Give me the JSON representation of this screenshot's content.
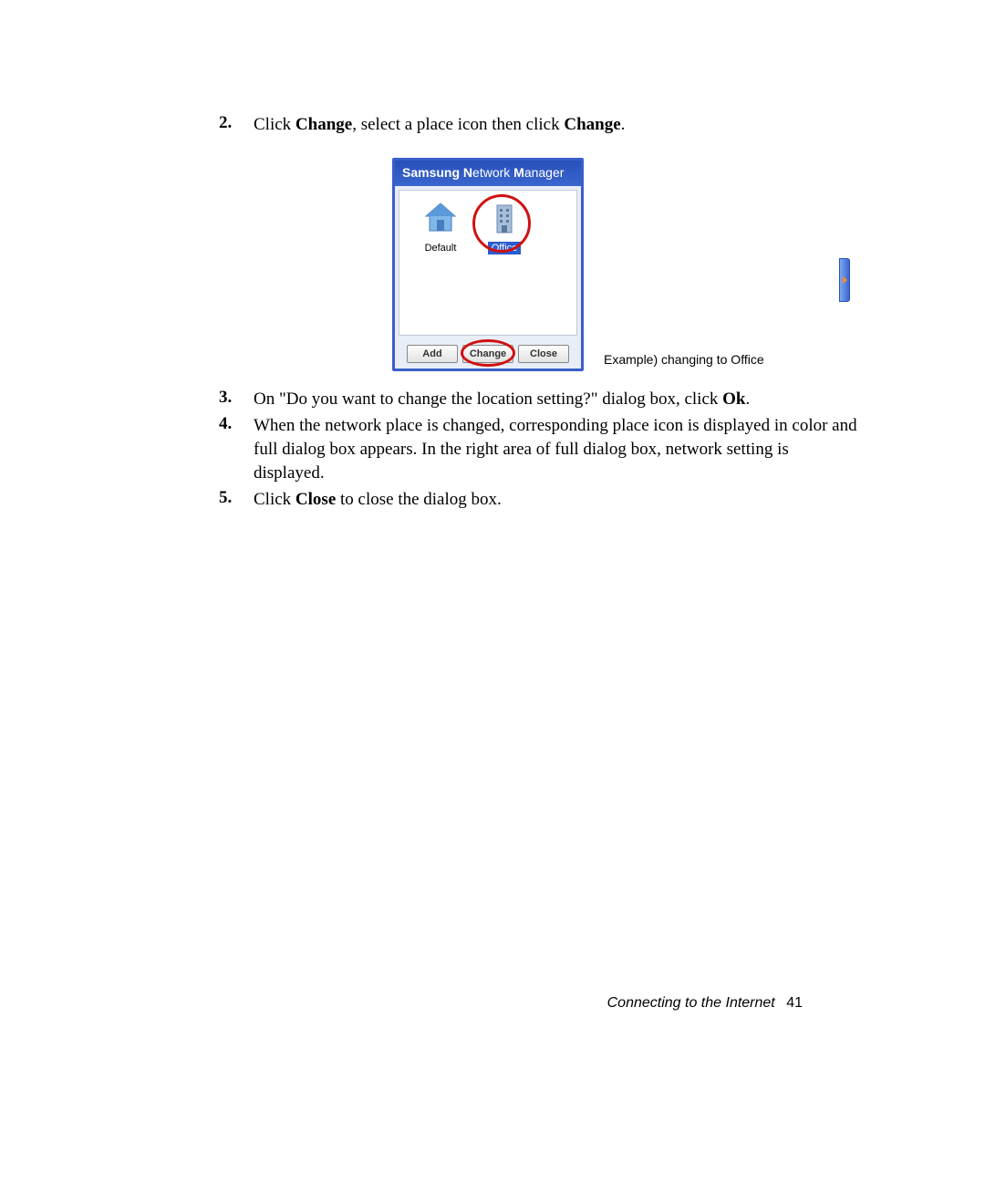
{
  "steps": {
    "s2": {
      "num": "2.",
      "pre": "Click ",
      "b1": "Change",
      "mid": ", select a place icon then click ",
      "b2": "Change",
      "post": "."
    },
    "s3": {
      "num": "3.",
      "pre": "On \"Do you want to change the location setting?\" dialog box, click ",
      "b1": "Ok",
      "post": "."
    },
    "s4": {
      "num": "4.",
      "text": "When the network place is changed, corresponding place icon is displayed in color and full dialog box appears. In the right area of full dialog box, network setting is displayed."
    },
    "s5": {
      "num": "5.",
      "pre": "Click ",
      "b1": "Close",
      "post": " to close the dialog box."
    }
  },
  "app": {
    "title_brand": "Samsung",
    "title_sub1": "N",
    "title_sub1b": "etwork",
    "title_sub2": "M",
    "title_sub2b": "anager",
    "places": {
      "default": "Default",
      "office": "Office"
    },
    "buttons": {
      "add": "Add",
      "change": "Change",
      "close": "Close"
    }
  },
  "caption": "Example) changing to Office",
  "footer": {
    "section": "Connecting to the Internet",
    "page": "41"
  }
}
